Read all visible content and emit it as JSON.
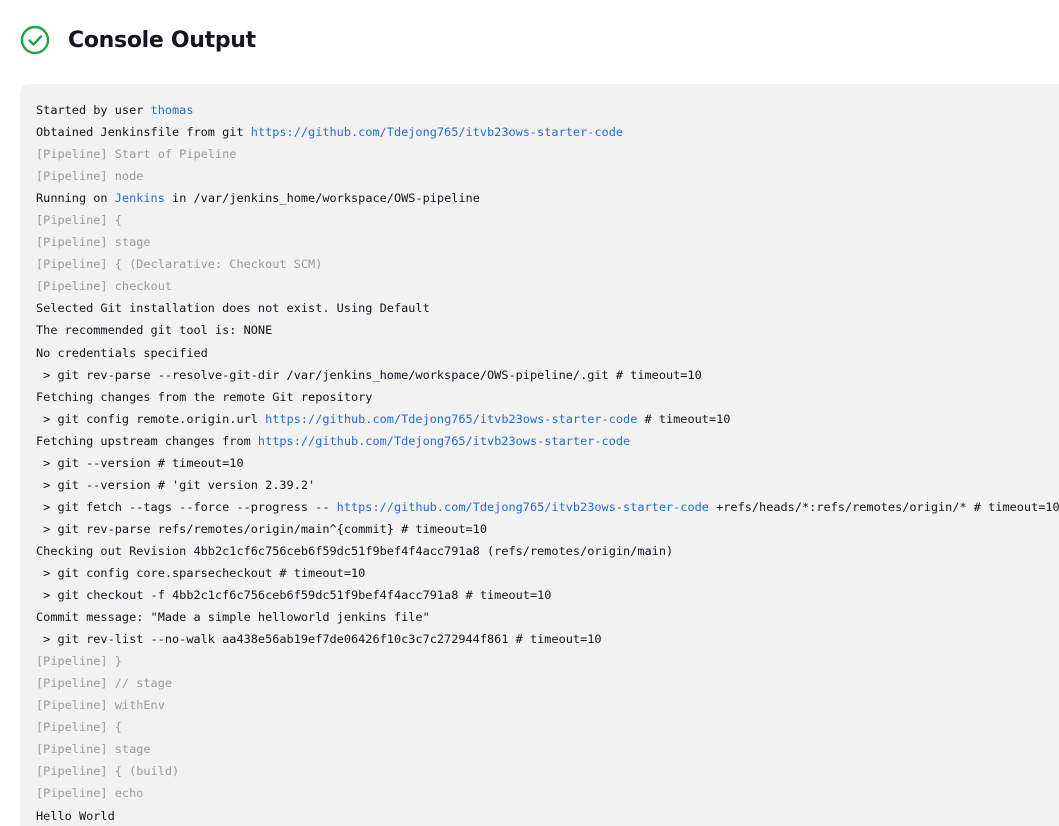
{
  "header": {
    "title": "Console Output",
    "status_icon": "check-circle-icon",
    "status_color": "#1ea446"
  },
  "colors": {
    "link": "#1f6fd0",
    "dim": "#9a9aa0",
    "console_bg": "#f2f2f3"
  },
  "console": {
    "lines": [
      {
        "kind": "normal",
        "parts": [
          {
            "t": "Started by user "
          },
          {
            "t": "thomas",
            "link": true
          }
        ]
      },
      {
        "kind": "normal",
        "parts": [
          {
            "t": "Obtained Jenkinsfile from git "
          },
          {
            "t": "https://github.com/Tdejong765/itvb23ows-starter-code",
            "link": true
          }
        ]
      },
      {
        "kind": "dim",
        "parts": [
          {
            "t": "[Pipeline] Start of Pipeline"
          }
        ]
      },
      {
        "kind": "dim",
        "parts": [
          {
            "t": "[Pipeline] node"
          }
        ]
      },
      {
        "kind": "normal",
        "parts": [
          {
            "t": "Running on "
          },
          {
            "t": "Jenkins",
            "link": true
          },
          {
            "t": " in /var/jenkins_home/workspace/OWS-pipeline"
          }
        ]
      },
      {
        "kind": "dim",
        "parts": [
          {
            "t": "[Pipeline] {"
          }
        ]
      },
      {
        "kind": "dim",
        "parts": [
          {
            "t": "[Pipeline] stage"
          }
        ]
      },
      {
        "kind": "dim",
        "parts": [
          {
            "t": "[Pipeline] { (Declarative: Checkout SCM)"
          }
        ]
      },
      {
        "kind": "dim",
        "parts": [
          {
            "t": "[Pipeline] checkout"
          }
        ]
      },
      {
        "kind": "normal",
        "parts": [
          {
            "t": "Selected Git installation does not exist. Using Default"
          }
        ]
      },
      {
        "kind": "normal",
        "parts": [
          {
            "t": "The recommended git tool is: NONE"
          }
        ]
      },
      {
        "kind": "normal",
        "parts": [
          {
            "t": "No credentials specified"
          }
        ]
      },
      {
        "kind": "normal",
        "parts": [
          {
            "t": " > git rev-parse --resolve-git-dir /var/jenkins_home/workspace/OWS-pipeline/.git # timeout=10"
          }
        ]
      },
      {
        "kind": "normal",
        "parts": [
          {
            "t": "Fetching changes from the remote Git repository"
          }
        ]
      },
      {
        "kind": "normal",
        "parts": [
          {
            "t": " > git config remote.origin.url "
          },
          {
            "t": "https://github.com/Tdejong765/itvb23ows-starter-code",
            "link": true
          },
          {
            "t": " # timeout=10"
          }
        ]
      },
      {
        "kind": "normal",
        "parts": [
          {
            "t": "Fetching upstream changes from "
          },
          {
            "t": "https://github.com/Tdejong765/itvb23ows-starter-code",
            "link": true
          }
        ]
      },
      {
        "kind": "normal",
        "parts": [
          {
            "t": " > git --version # timeout=10"
          }
        ]
      },
      {
        "kind": "normal",
        "parts": [
          {
            "t": " > git --version # 'git version 2.39.2'"
          }
        ]
      },
      {
        "kind": "normal",
        "parts": [
          {
            "t": " > git fetch --tags --force --progress -- "
          },
          {
            "t": "https://github.com/Tdejong765/itvb23ows-starter-code",
            "link": true
          },
          {
            "t": " +refs/heads/*:refs/remotes/origin/* # timeout=10"
          }
        ]
      },
      {
        "kind": "normal",
        "parts": [
          {
            "t": " > git rev-parse refs/remotes/origin/main^{commit} # timeout=10"
          }
        ]
      },
      {
        "kind": "normal",
        "parts": [
          {
            "t": "Checking out Revision 4bb2c1cf6c756ceb6f59dc51f9bef4f4acc791a8 (refs/remotes/origin/main)"
          }
        ]
      },
      {
        "kind": "normal",
        "parts": [
          {
            "t": " > git config core.sparsecheckout # timeout=10"
          }
        ]
      },
      {
        "kind": "normal",
        "parts": [
          {
            "t": " > git checkout -f 4bb2c1cf6c756ceb6f59dc51f9bef4f4acc791a8 # timeout=10"
          }
        ]
      },
      {
        "kind": "normal",
        "parts": [
          {
            "t": "Commit message: \"Made a simple helloworld jenkins file\""
          }
        ]
      },
      {
        "kind": "normal",
        "parts": [
          {
            "t": " > git rev-list --no-walk aa438e56ab19ef7de06426f10c3c7c272944f861 # timeout=10"
          }
        ]
      },
      {
        "kind": "dim",
        "parts": [
          {
            "t": "[Pipeline] }"
          }
        ]
      },
      {
        "kind": "dim",
        "parts": [
          {
            "t": "[Pipeline] // stage"
          }
        ]
      },
      {
        "kind": "dim",
        "parts": [
          {
            "t": "[Pipeline] withEnv"
          }
        ]
      },
      {
        "kind": "dim",
        "parts": [
          {
            "t": "[Pipeline] {"
          }
        ]
      },
      {
        "kind": "dim",
        "parts": [
          {
            "t": "[Pipeline] stage"
          }
        ]
      },
      {
        "kind": "dim",
        "parts": [
          {
            "t": "[Pipeline] { (build)"
          }
        ]
      },
      {
        "kind": "dim",
        "parts": [
          {
            "t": "[Pipeline] echo"
          }
        ]
      },
      {
        "kind": "normal",
        "parts": [
          {
            "t": "Hello World"
          }
        ]
      }
    ]
  }
}
